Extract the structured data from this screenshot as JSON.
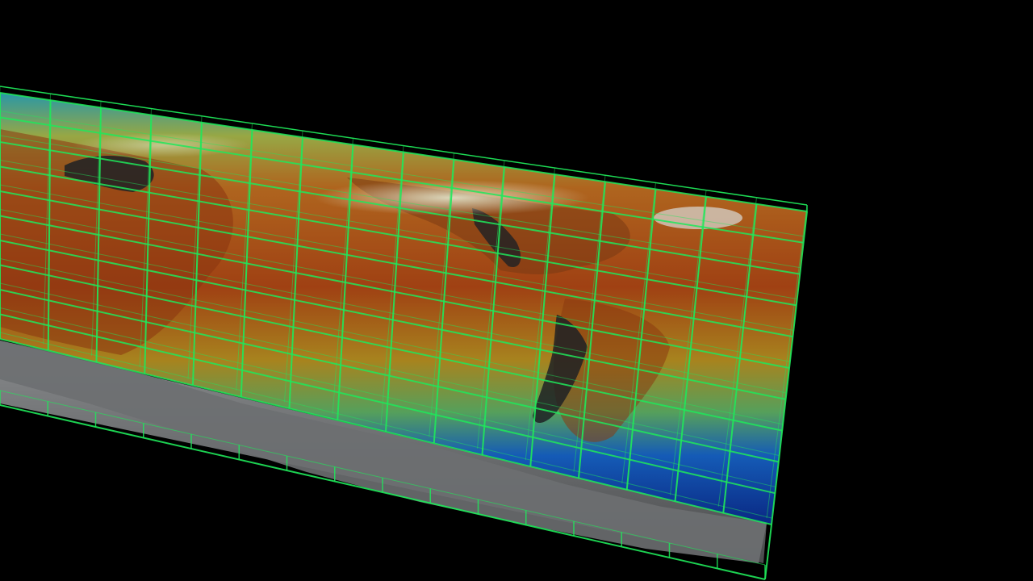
{
  "scene": {
    "background_color": "#000000",
    "grid_color": "#1fe85a",
    "terrain_color": "#6a6c6e",
    "colormap": [
      "#0a2a8a",
      "#1660c0",
      "#2aa0c0",
      "#66b060",
      "#c0a030",
      "#c86418",
      "#a83010"
    ],
    "grid_columns": 16,
    "grid_rows": 10
  }
}
